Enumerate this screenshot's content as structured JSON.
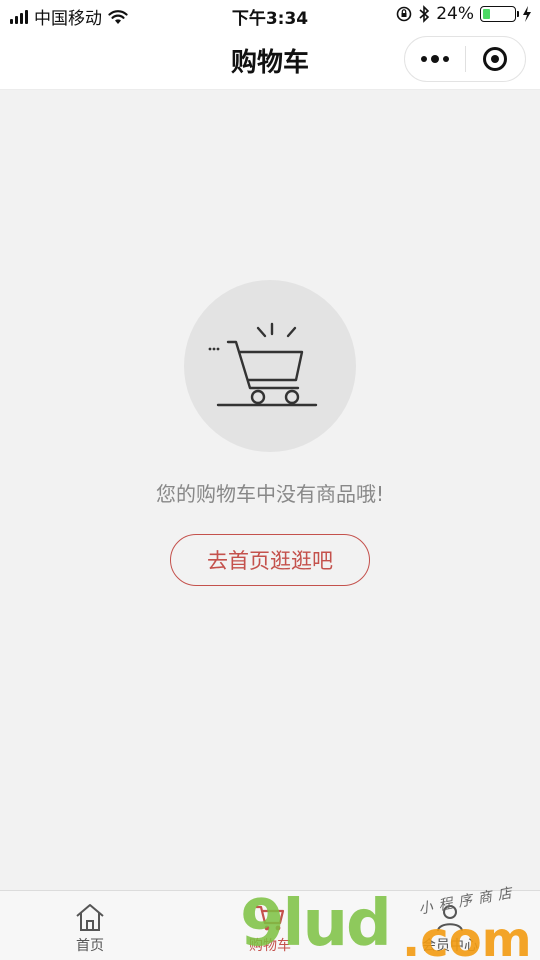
{
  "status_bar": {
    "carrier": "中国移动",
    "time": "下午3:34",
    "battery_percent": "24%",
    "battery_level": 0.24,
    "icons": [
      "signal-icon",
      "wifi-icon",
      "orientation-lock-icon",
      "bluetooth-icon",
      "battery-icon",
      "charging-icon"
    ]
  },
  "nav": {
    "title": "购物车",
    "more_icon": "more-dots-icon",
    "close_icon": "target-circle-icon"
  },
  "empty_state": {
    "icon": "shopping-cart-icon",
    "message": "您的购物车中没有商品哦!",
    "button_label": "去首页逛逛吧"
  },
  "tab_bar": {
    "items": [
      {
        "label": "首页",
        "icon": "home-icon"
      },
      {
        "label": "购物车",
        "icon": "cart-icon"
      },
      {
        "label": "会员中心",
        "icon": "user-icon"
      }
    ],
    "active_index": 1
  },
  "watermark": {
    "brand": "9lud",
    "domain": ".com",
    "tagline": "小程序商店"
  },
  "colors": {
    "accent": "#c4514c",
    "background": "#f2f2f2",
    "battery_fill": "#4cd964",
    "watermark_green": "#7cc242",
    "watermark_orange": "#f39c12"
  }
}
